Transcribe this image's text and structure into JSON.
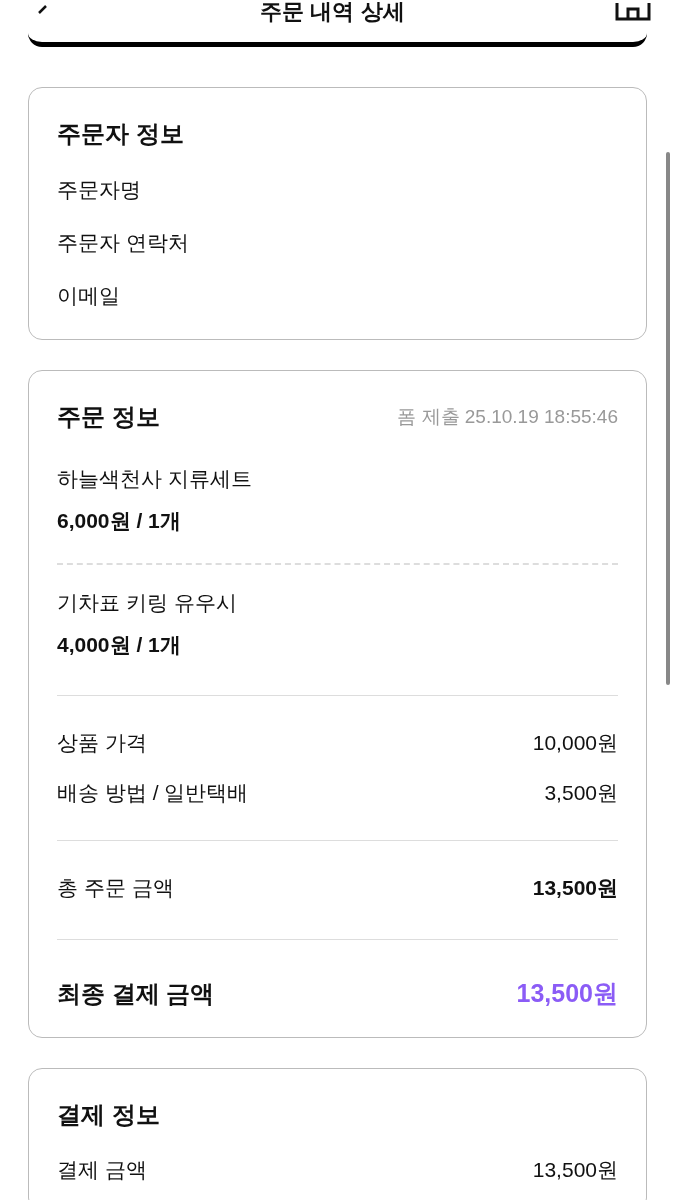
{
  "header": {
    "title": "주문 내역 상세"
  },
  "orderer": {
    "title": "주문자 정보",
    "fields": [
      "주문자명",
      "주문자 연락처",
      "이메일"
    ]
  },
  "order": {
    "title": "주문 정보",
    "submitted": "폼 제출 25.10.19 18:55:46",
    "items": [
      {
        "name": "하늘색천사 지류세트",
        "price": "6,000원 / 1개"
      },
      {
        "name": "기차표 키링 유우시",
        "price": "4,000원 / 1개"
      }
    ],
    "costs": [
      {
        "label": "상품 가격",
        "value": "10,000원"
      },
      {
        "label": "배송 방법 / 일반택배",
        "value": "3,500원"
      }
    ],
    "total": {
      "label": "총 주문 금액",
      "value": "13,500원"
    },
    "final": {
      "label": "최종 결제 금액",
      "value": "13,500원"
    }
  },
  "payment": {
    "title": "결제 정보",
    "rows": [
      {
        "label": "결제 금액",
        "value": "13,500원"
      }
    ]
  }
}
